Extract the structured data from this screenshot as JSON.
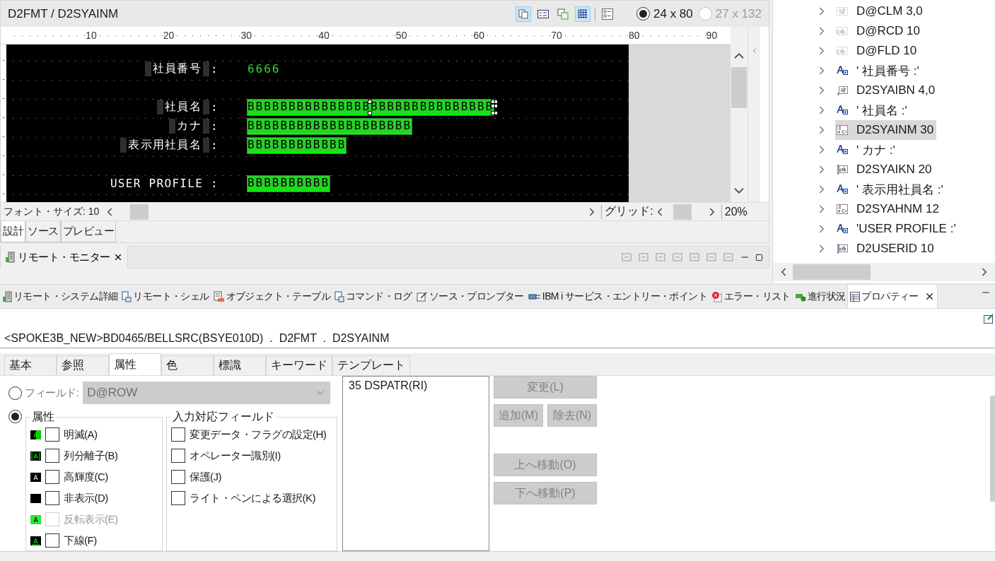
{
  "editor": {
    "title": "D2FMT / D2SYAINM",
    "tools": [
      {
        "kind": "layout",
        "pressed": true
      },
      {
        "kind": "prompt",
        "pressed": false
      },
      {
        "kind": "field-type",
        "pressed": false
      },
      {
        "kind": "grid",
        "pressed": true
      },
      {
        "kind": "list",
        "pressed": false
      }
    ],
    "sizes": [
      {
        "label": "24 x 80",
        "selected": true,
        "disabled": false
      },
      {
        "label": "27 x 132",
        "selected": false,
        "disabled": true
      }
    ],
    "ruler": [
      "10",
      "20",
      "30",
      "40",
      "50",
      "60",
      "70",
      "80",
      "90"
    ],
    "screen": {
      "rows": [
        {
          "label": {
            "text": "社員番号",
            "delimited": true,
            "suffix": ":"
          },
          "field": {
            "kind": "output",
            "value": "6666",
            "selected": false
          }
        },
        {
          "label": {
            "text": "社員名",
            "delimited": true,
            "suffix": ":"
          },
          "field": {
            "kind": "input",
            "value": "BBBBBBBBBBBBBBBBBBBBBBBBBBBBBB",
            "selected": true
          }
        },
        {
          "label": {
            "text": "カナ",
            "delimited": true,
            "suffix": ":"
          },
          "field": {
            "kind": "input",
            "value": "BBBBBBBBBBBBBBBBBBBB",
            "selected": false
          }
        },
        {
          "label": {
            "text": "表示用社員名",
            "delimited": true,
            "suffix": ":"
          },
          "field": {
            "kind": "input",
            "value": "BBBBBBBBBBBB",
            "selected": false
          }
        },
        {
          "label": {
            "text": "USER PROFILE :",
            "delimited": false
          },
          "field": {
            "kind": "input",
            "value": "BBBBBBBBBB",
            "selected": false
          }
        }
      ]
    },
    "font_size": "フォント・サイズ: 10",
    "grid_label": "グリッド:",
    "zoom": "20%",
    "tabs": [
      {
        "label": "設計",
        "selected": true
      },
      {
        "label": "ソース",
        "selected": false
      },
      {
        "label": "プレビュー",
        "selected": false
      }
    ]
  },
  "monitor": {
    "tab": "リモート・モニター"
  },
  "outline": {
    "items": [
      {
        "kind": "hidden-number",
        "label": "D@CLM 3,0",
        "expanded": false,
        "selected": false
      },
      {
        "kind": "hidden-text",
        "label": "D@RCD 10",
        "expanded": false,
        "selected": false
      },
      {
        "kind": "hidden-text",
        "label": "D@FLD 10",
        "expanded": false,
        "selected": false
      },
      {
        "kind": "constant",
        "label": "' 社員番号 :'",
        "expanded": false,
        "selected": false
      },
      {
        "kind": "output-number",
        "label": "D2SYAIBN 4,0",
        "expanded": false,
        "selected": false
      },
      {
        "kind": "constant",
        "label": "' 社員名 :'",
        "expanded": false,
        "selected": false
      },
      {
        "kind": "mixed",
        "label": "D2SYAINM 30",
        "expanded": false,
        "selected": true
      },
      {
        "kind": "constant",
        "label": "' カナ :'",
        "expanded": false,
        "selected": false
      },
      {
        "kind": "input-text",
        "label": "D2SYAIKN 20",
        "expanded": false,
        "selected": false
      },
      {
        "kind": "constant",
        "label": "' 表示用社員名 :'",
        "expanded": false,
        "selected": false
      },
      {
        "kind": "mixed",
        "label": "D2SYAHNM 12",
        "expanded": false,
        "selected": false
      },
      {
        "kind": "constant",
        "label": "'USER PROFILE :'",
        "expanded": false,
        "selected": false
      },
      {
        "kind": "input-text",
        "label": "D2USERID 10",
        "expanded": false,
        "selected": false
      }
    ]
  },
  "views": {
    "tabs": [
      {
        "kind": "server",
        "label": "リモート・システム詳細",
        "selected": false
      },
      {
        "kind": "shell",
        "label": "リモート・シェル",
        "selected": false
      },
      {
        "kind": "table",
        "label": "オブジェクト・テーブル",
        "selected": false
      },
      {
        "kind": "log",
        "label": "コマンド・ログ",
        "selected": false
      },
      {
        "kind": "prompter",
        "label": "ソース・プロンプター",
        "selected": false
      },
      {
        "kind": "service",
        "label": "IBM i サービス・エントリー・ポイント",
        "selected": false
      },
      {
        "kind": "error",
        "label": "エラー・リスト",
        "selected": false
      },
      {
        "kind": "progress",
        "label": "進行状況",
        "selected": false
      },
      {
        "kind": "properties",
        "label": "プロパティー",
        "selected": true
      }
    ]
  },
  "properties": {
    "path": "<SPOKE3B_NEW>BD0465/BELLSRC(BSYE010D)  .  D2FMT  .  D2SYAINM",
    "tabs": [
      {
        "label": "基本",
        "selected": false
      },
      {
        "label": "参照",
        "selected": false
      },
      {
        "label": "属性",
        "selected": true
      },
      {
        "label": "色",
        "selected": false
      },
      {
        "label": "標識",
        "selected": false
      },
      {
        "label": "キーワード",
        "selected": false
      },
      {
        "label": "テンプレート",
        "selected": false
      }
    ],
    "field_option": {
      "label": "フィールド:",
      "selected": false,
      "value": "D@ROW"
    },
    "attr_option": {
      "label": "属性",
      "selected": true
    },
    "attributes": [
      {
        "kind": "blink",
        "label": "明滅(A)",
        "checked": false,
        "disabled": false
      },
      {
        "kind": "column-separator",
        "label": "列分離子(B)",
        "checked": false,
        "disabled": false
      },
      {
        "kind": "high-intensity",
        "label": "高輝度(C)",
        "checked": false,
        "disabled": false
      },
      {
        "kind": "non-display",
        "label": "非表示(D)",
        "checked": false,
        "disabled": false
      },
      {
        "kind": "reverse",
        "label": "反転表示(E)",
        "checked": false,
        "disabled": true
      },
      {
        "kind": "underline",
        "label": "下線(F)",
        "checked": false,
        "disabled": false
      }
    ],
    "input_group": {
      "title": "入力対応フィールド",
      "items": [
        {
          "label": "変更データ・フラグの設定(H)",
          "checked": false
        },
        {
          "label": "オペレーター識別(I)",
          "checked": false
        },
        {
          "label": "保護(J)",
          "checked": false
        },
        {
          "label": "ライト・ペンによる選択(K)",
          "checked": false
        }
      ]
    },
    "list": [
      "35 DSPATR(RI)"
    ],
    "buttons": [
      {
        "kind": "wide",
        "label": "変更(L)",
        "disabled": true
      },
      {
        "kind": "half",
        "label": "追加(M)",
        "disabled": true
      },
      {
        "kind": "half",
        "label": "除去(N)",
        "disabled": true
      },
      {
        "kind": "wide",
        "label": "上へ移動(O)",
        "disabled": true
      },
      {
        "kind": "wide",
        "label": "下へ移動(P)",
        "disabled": true
      }
    ]
  }
}
